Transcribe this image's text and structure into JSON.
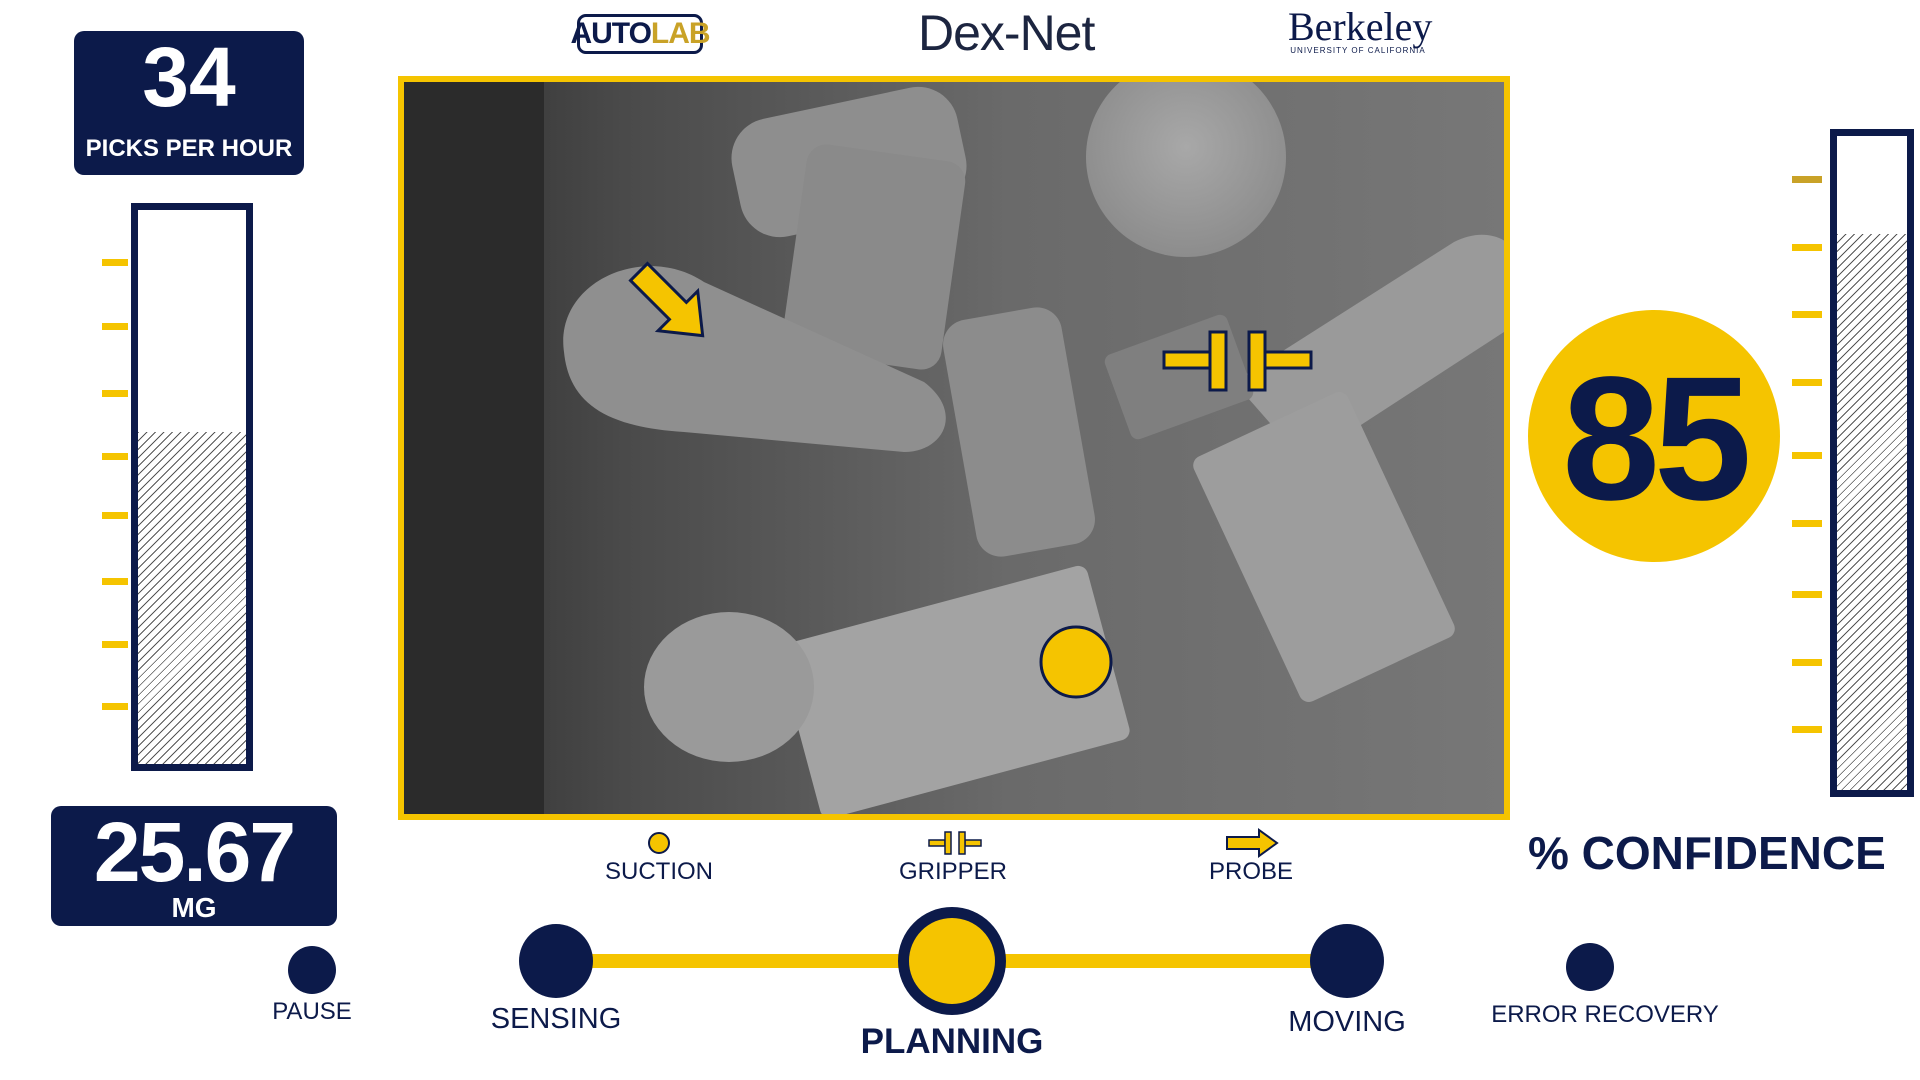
{
  "header": {
    "logo_autolab_part1": "AUTO",
    "logo_autolab_part2": "LAB",
    "logo_dexnet": "Dex-Net",
    "logo_berkeley": "Berkeley",
    "logo_berkeley_sub": "UNIVERSITY OF CALIFORNIA"
  },
  "left_panel": {
    "picks_per_hour_value": "34",
    "picks_per_hour_label": "PICKS PER HOUR",
    "picks_gauge_fill_fraction": 0.6,
    "mass_value": "25.67",
    "mass_unit": "MG"
  },
  "legend": {
    "suction_label": "SUCTION",
    "gripper_label": "GRIPPER",
    "probe_label": "PROBE"
  },
  "right_panel": {
    "confidence_value": "85",
    "confidence_label": "% CONFIDENCE",
    "confidence_gauge_fill_fraction": 0.85
  },
  "pipeline": {
    "pause_label": "PAUSE",
    "sensing_label": "SENSING",
    "planning_label": "PLANNING",
    "moving_label": "MOVING",
    "error_recovery_label": "ERROR RECOVERY",
    "active_step": "PLANNING"
  },
  "colors": {
    "navy": "#0c1a4a",
    "accent_yellow": "#f5c400",
    "gold": "#c9a227"
  },
  "icons": {
    "suction": "circle-icon",
    "gripper": "parallel-jaw-icon",
    "probe": "arrow-icon"
  }
}
